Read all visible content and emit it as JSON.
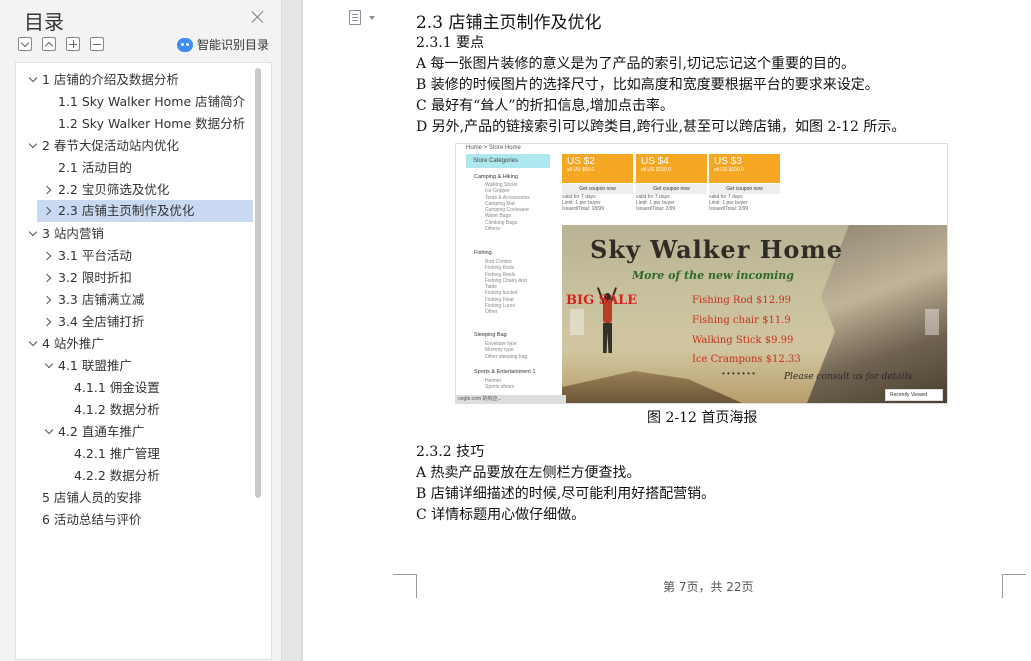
{
  "toc": {
    "title": "目录",
    "smart_label": "智能识别目录",
    "items": [
      {
        "label": "1 店铺的介绍及数据分析"
      },
      {
        "label": "1.1 Sky Walker Home 店铺简介"
      },
      {
        "label": "1.2 Sky Walker Home 数据分析"
      },
      {
        "label": "2 春节大促活动站内优化"
      },
      {
        "label": "2.1 活动目的"
      },
      {
        "label": "2.2 宝贝筛选及优化"
      },
      {
        "label": "2.3 店铺主页制作及优化"
      },
      {
        "label": "3 站内营销"
      },
      {
        "label": "3.1 平台活动"
      },
      {
        "label": "3.2 限时折扣"
      },
      {
        "label": "3.3 店铺满立减"
      },
      {
        "label": "3.4 全店铺打折"
      },
      {
        "label": "4 站外推广"
      },
      {
        "label": "4.1 联盟推广"
      },
      {
        "label": "4.1.1  佣金设置"
      },
      {
        "label": "4.1.2  数据分析"
      },
      {
        "label": "4.2 直通车推广"
      },
      {
        "label": "4.2.1 推广管理"
      },
      {
        "label": "4.2.2 数据分析"
      },
      {
        "label": "5 店铺人员的安排"
      },
      {
        "label": "6 活动总结与评价"
      }
    ]
  },
  "doc": {
    "heading": "2.3 店铺主页制作及优化",
    "sub1": "2.3.1 要点",
    "para_a": "A 每一张图片装修的意义是为了产品的索引,切记忘记这个重要的目的。",
    "para_b": "B 装修的时候图片的选择尺寸，比如高度和宽度要根据平台的要求来设定。",
    "para_c": "C 最好有“耸人”的折扣信息,增加点击率。",
    "para_d": "D 另外,产品的链接索引可以跨类目,跨行业,甚至可以跨店铺，如图 2-12 所示。",
    "figure_caption": "图 2-12 首页海报",
    "sub2": "2.3.2 技巧",
    "tip_a": "A 热卖产品要放在左侧栏方便查找。",
    "tip_b": "B 店铺详细描述的时候,尽可能利用好搭配营销。",
    "tip_c": "C 详情标题用心做仔细做。",
    "footer": "第 7页，共 22页"
  },
  "figure": {
    "breadcrumb": "Home > Store Home",
    "cat_header": "Store Categories",
    "groups": [
      {
        "name": "Camping & Hiking",
        "subs": [
          "Walking Sticks",
          "Ice Gripper",
          "Tents & Accessories",
          "Camping Mat",
          "Camping Cookware",
          "Water Bags",
          "Climbing Bags",
          "Others"
        ]
      },
      {
        "name": "Fishing",
        "subs": [
          "Rod Combo",
          "Fishing Rods",
          "Fishing Reels",
          "Fishing Chairs And",
          "Table",
          "Fishing bucket",
          "Fishing Float",
          "Fishing Lures",
          "Other"
        ]
      },
      {
        "name": "Sleeping Bag",
        "subs": [
          "Envelope type",
          "Mummy type",
          "Other sleeping bag"
        ]
      },
      {
        "name": "Sports & Entertainment 1",
        "subs": [
          "Helmet",
          "Sports shoes"
        ]
      }
    ],
    "coupons": [
      {
        "amount": "US $2",
        "cond": "all US $50.0",
        "get": "Get coupon now",
        "valid": "valid for 7 days",
        "limit": "Limit: 1 per buyer",
        "issued": "Issued/Total: 18/99"
      },
      {
        "amount": "US $4",
        "cond": "all US $150.0",
        "get": "Get coupon now",
        "valid": "valid for 7 days",
        "limit": "Limit: 1 per buyer",
        "issued": "Issued/Total: 2/99"
      },
      {
        "amount": "US $3",
        "cond": "all US $100.0",
        "get": "Get coupon now",
        "valid": "valid for 7 days",
        "limit": "Limit: 1 per buyer",
        "issued": "Issued/Total: 2/99"
      }
    ],
    "banner_title": "Sky Walker Home",
    "banner_sub": "More of the new incoming",
    "big_sale": "BIG SALE",
    "deals": [
      "Fishing Rod $12.99",
      "Fishing chair $11.9",
      "Walking Stick $9.99",
      "Ice Crampons $12.33"
    ],
    "dots": "• • • • • • •",
    "consult": "Please consult us for details",
    "recent": "Recently Viewed",
    "status": "oogle.com 的响应..."
  }
}
